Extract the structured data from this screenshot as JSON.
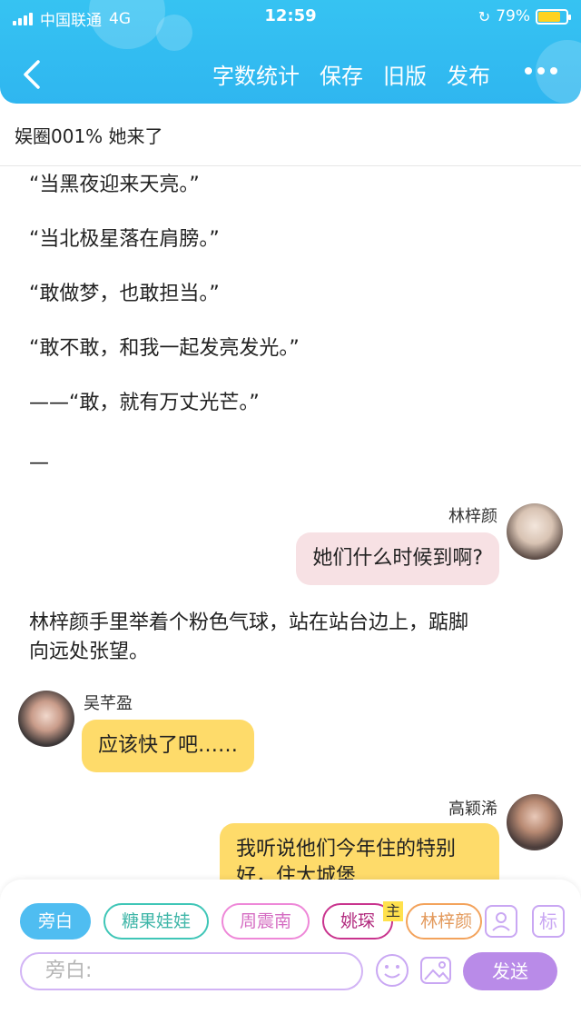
{
  "status_bar": {
    "carrier": "中国联通",
    "network": "4G",
    "time": "12:59",
    "battery": "79%",
    "battery_level": 0.79
  },
  "nav": {
    "word_count": "字数统计",
    "save": "保存",
    "old_version": "旧版",
    "publish": "发布"
  },
  "doc_title": "娱圈001%  她来了",
  "paragraphs": [
    "“当黑夜迎来天亮。”",
    "“当北极星落在肩膀。”",
    "“敢做梦，也敢担当。”",
    "“敢不敢，和我一起发亮发光。”",
    "——“敢，就有万丈光芒。”",
    "—"
  ],
  "messages": [
    {
      "speaker": "林梓颜",
      "text": "她们什么时候到啊?"
    },
    {
      "speaker": "吴芊盈",
      "text": "应该快了吧……"
    },
    {
      "speaker": "高颖浠",
      "text": "我听说他们今年住的特别好，住大城堡"
    }
  ],
  "narration": [
    "林梓颜手里举着个粉色气球，站在站台边上，踮脚",
    "向远处张望。"
  ],
  "toolbar": {
    "chips": [
      "旁白",
      "糖果娃娃",
      "周震南",
      "姚琛",
      "林梓颜"
    ],
    "main_tag": "主",
    "tag_button": "标",
    "input_placeholder": "旁白:",
    "send": "发送"
  },
  "colors": {
    "header": "#36c3f2",
    "pink_bubble": "#f7e1e4",
    "yellow_bubble": "#fedb6a",
    "send": "#b98be8"
  }
}
